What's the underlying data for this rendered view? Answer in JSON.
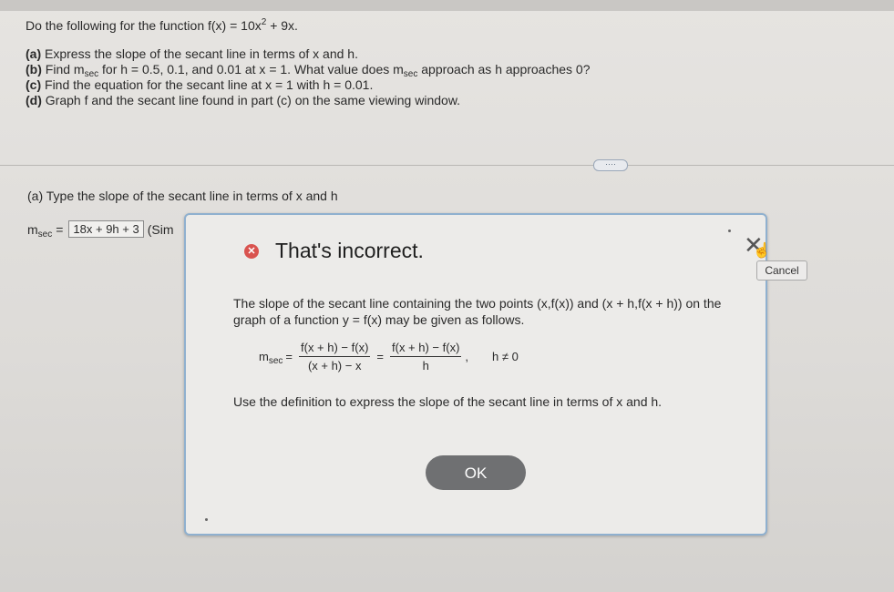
{
  "problem": {
    "intro_prefix": "Do the following for the function f(x) = 10x",
    "intro_exp": "2",
    "intro_suffix": " + 9x.",
    "part_a_label": "(a)",
    "part_a_text": "Express the slope of the secant line in terms of x and h.",
    "part_b_label": "(b)",
    "part_b_text1": "Find m",
    "part_b_sub1": "sec",
    "part_b_text2": " for h = 0.5, 0.1, and 0.01 at x = 1. What value does m",
    "part_b_sub2": "sec",
    "part_b_text3": " approach as h approaches 0?",
    "part_c_label": "(c)",
    "part_c_text": "Find the equation for the secant line at x = 1 with h = 0.01.",
    "part_d_label": "(d)",
    "part_d_text": "Graph f and the secant line found in part (c) on the same viewing window."
  },
  "more_button": "····",
  "answer": {
    "prompt_label": "(a)",
    "prompt_text": "Type the slope of the secant line in terms of x and h",
    "msec_m": "m",
    "msec_sub": "sec",
    "equals": "=",
    "value": "18x + 9h + 3",
    "note": "(Sim"
  },
  "dialog": {
    "status": "That's incorrect.",
    "explain": "The slope of the secant line containing the two points (x,f(x)) and (x + h,f(x + h)) on the graph of a function y = f(x) may be given as follows.",
    "formula_m": "m",
    "formula_sub": "sec",
    "eq": "=",
    "frac1_num": "f(x + h) − f(x)",
    "frac1_den": "(x + h) − x",
    "frac2_num": "f(x + h) − f(x)",
    "frac2_den": "h",
    "comma": ",",
    "condition": "h ≠ 0",
    "instruction": "Use the definition to express the slope of the secant line in terms of x and h.",
    "ok_label": "OK"
  },
  "cancel_label": "Cancel",
  "icons": {
    "close": "close-icon",
    "error": "error-icon",
    "hand": "hand-pointer-icon"
  },
  "colors": {
    "error": "#d9534f",
    "dialog_border": "#8fb0cf",
    "ok_button": "#6f7072"
  }
}
